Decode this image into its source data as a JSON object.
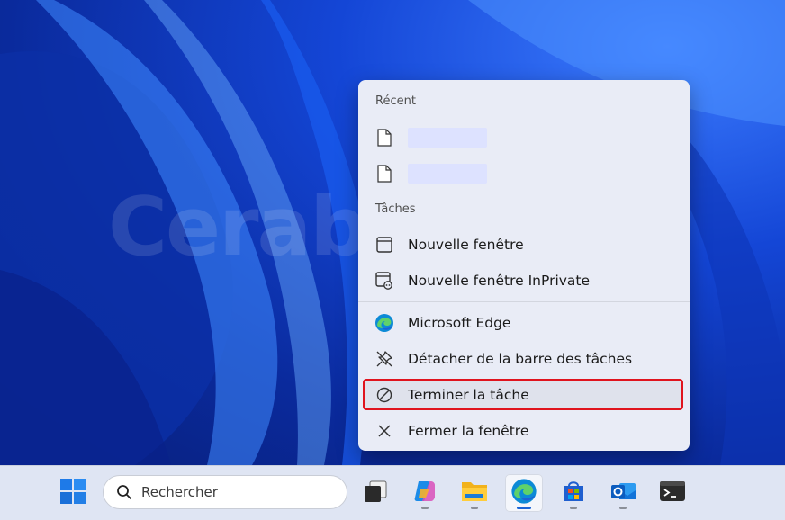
{
  "desktop": {
    "watermark": "Cerabeinfo"
  },
  "jumplist": {
    "recent_title": "Récent",
    "tasks_title": "Tâches",
    "tasks": [
      {
        "label": "Nouvelle fenêtre",
        "icon": "window-icon"
      },
      {
        "label": "Nouvelle fenêtre InPrivate",
        "icon": "inprivate-window-icon"
      }
    ],
    "actions": [
      {
        "label": "Microsoft Edge",
        "icon": "edge-icon"
      },
      {
        "label": "Détacher de la barre des tâches",
        "icon": "unpin-icon"
      },
      {
        "label": "Terminer la tâche",
        "icon": "end-task-icon",
        "highlighted": true
      },
      {
        "label": "Fermer la fenêtre",
        "icon": "close-icon"
      }
    ]
  },
  "taskbar": {
    "search_placeholder": "Rechercher",
    "apps": [
      "task-view",
      "copilot",
      "file-explorer",
      "microsoft-edge",
      "microsoft-store",
      "outlook",
      "terminal"
    ],
    "active_app": "microsoft-edge"
  },
  "colors": {
    "highlight_border": "#e0141e",
    "menu_bg": "#e9ecf6",
    "taskbar_bg": "#dfe5f3"
  }
}
